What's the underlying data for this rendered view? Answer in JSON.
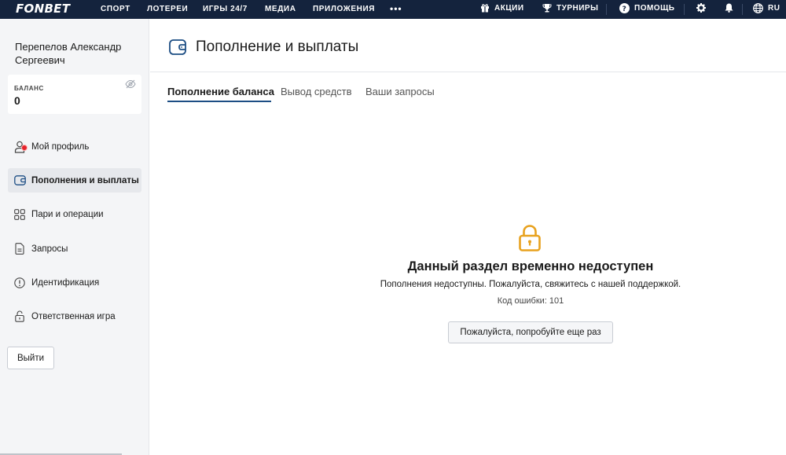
{
  "topnav": {
    "logo": "FONBET",
    "items": [
      "СПОРТ",
      "ЛОТЕРЕИ",
      "ИГРЫ 24/7",
      "МЕДИА",
      "ПРИЛОЖЕНИЯ"
    ],
    "more": "•••",
    "promo": "АКЦИИ",
    "tournaments": "ТУРНИРЫ",
    "help": "ПОМОЩЬ",
    "lang": "RU",
    "icons": [
      "gift-icon",
      "trophy-icon",
      "help-icon",
      "gear-icon",
      "bell-icon",
      "globe-icon"
    ]
  },
  "sidebar": {
    "user_name": "Перепелов Александр Сергеевич",
    "balance_label": "БАЛАНС",
    "balance_value": "0",
    "items": [
      {
        "label": "Мой профиль",
        "icon": "profile-icon",
        "has_notification": true
      },
      {
        "label": "Пополнения и выплаты",
        "icon": "wallet-icon",
        "active": true
      },
      {
        "label": "Пари и операции",
        "icon": "grid-icon"
      },
      {
        "label": "Запросы",
        "icon": "document-icon"
      },
      {
        "label": "Идентификация",
        "icon": "alert-icon"
      },
      {
        "label": "Ответственная игра",
        "icon": "lock-icon"
      }
    ],
    "logout": "Выйти"
  },
  "main": {
    "title": "Пополнение и выплаты",
    "tabs": [
      {
        "label": "Пополнение баланса",
        "active": true
      },
      {
        "label": "Вывод средств"
      },
      {
        "label": "Ваши запросы"
      }
    ],
    "notice": {
      "title": "Данный раздел временно недоступен",
      "text": "Пополнения недоступны. Пожалуйста, свяжитесь с нашей поддержкой.",
      "code": "Код ошибки: 101",
      "retry": "Пожалуйста, попробуйте еще раз"
    }
  },
  "colors": {
    "topbar": "#14233d",
    "accent": "#1d4e84",
    "lock": "#e8a21f",
    "notification": "#e5222b"
  }
}
